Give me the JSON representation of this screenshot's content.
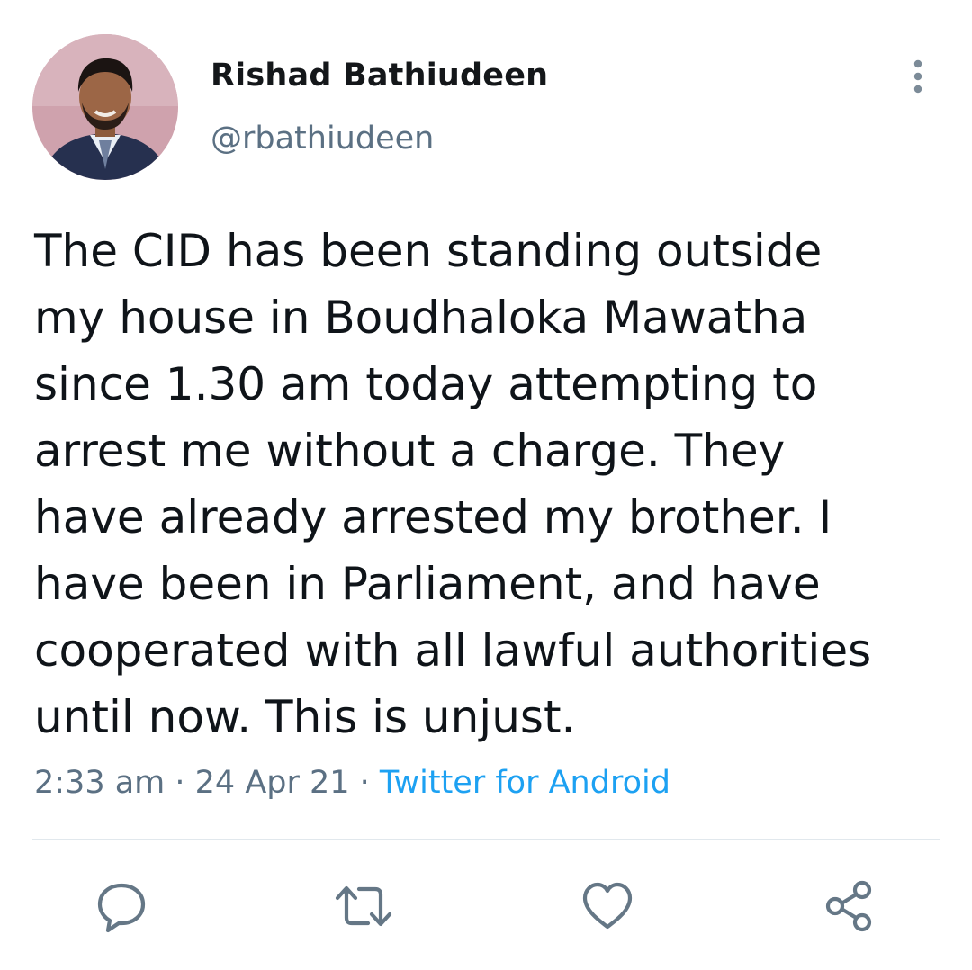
{
  "author": {
    "display_name": "Rishad Bathiudeen",
    "handle": "@rbathiudeen"
  },
  "tweet": {
    "text": "The CID has been standing outside\nmy house in Boudhaloka Mawatha\nsince 1.30 am today attempting to\narrest me without a charge. They\nhave already arrested my brother. I\nhave been in Parliament, and have\ncooperated with all lawful authorities\nuntil now. This is unjust.",
    "time": "2:33 am",
    "separator": " · ",
    "date": "24 Apr 21",
    "source": "Twitter for Android"
  },
  "icons": {
    "more": "more-vertical-icon",
    "reply": "reply-icon",
    "retweet": "retweet-icon",
    "like": "heart-icon",
    "share": "share-icon"
  },
  "colors": {
    "text": "#0f1419",
    "secondary": "#5b7083",
    "accent": "#1da1f2",
    "divider": "#e1e8ed"
  }
}
